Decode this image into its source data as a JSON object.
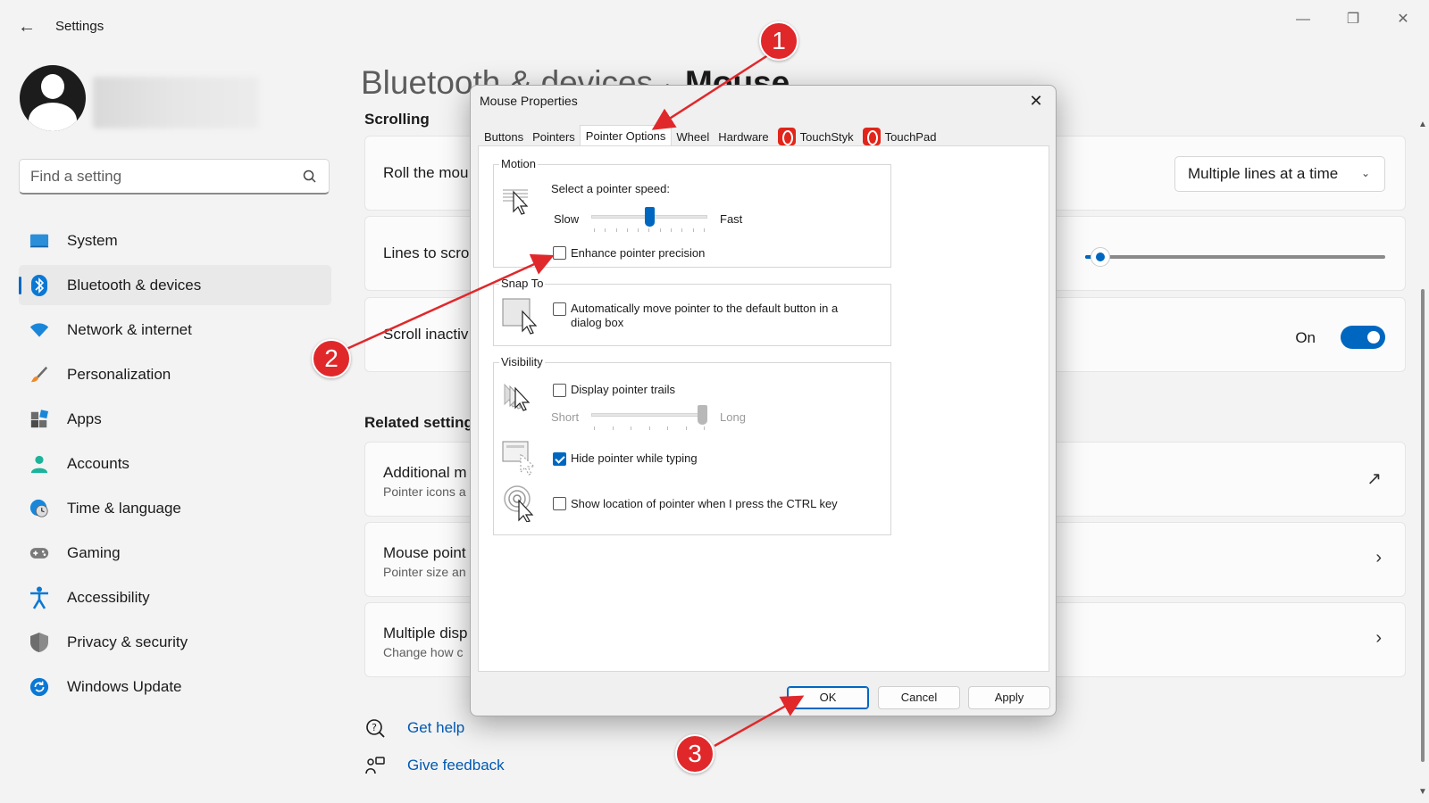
{
  "app": {
    "title": "Settings"
  },
  "search": {
    "placeholder": "Find a setting"
  },
  "sidebar": {
    "items": [
      {
        "label": "System",
        "icon": "system-icon"
      },
      {
        "label": "Bluetooth & devices",
        "icon": "bluetooth-icon",
        "active": true
      },
      {
        "label": "Network & internet",
        "icon": "wifi-icon"
      },
      {
        "label": "Personalization",
        "icon": "brush-icon"
      },
      {
        "label": "Apps",
        "icon": "apps-icon"
      },
      {
        "label": "Accounts",
        "icon": "accounts-icon"
      },
      {
        "label": "Time & language",
        "icon": "clock-globe-icon"
      },
      {
        "label": "Gaming",
        "icon": "gamepad-icon"
      },
      {
        "label": "Accessibility",
        "icon": "accessibility-icon"
      },
      {
        "label": "Privacy & security",
        "icon": "shield-icon"
      },
      {
        "label": "Windows Update",
        "icon": "update-icon"
      }
    ]
  },
  "header": {
    "crumb": "Bluetooth & devices",
    "separator": "›",
    "title": "Mouse"
  },
  "main": {
    "scrolling_label": "Scrolling",
    "roll_title": "Roll the mou",
    "roll_value": "Multiple lines at a time",
    "lines_title": "Lines to scro",
    "lines_slider_value": 0.05,
    "scroll_inactive_title": "Scroll inactiv",
    "scroll_inactive_state": "On",
    "related_label": "Related setting",
    "related": [
      {
        "title": "Additional m",
        "sub": "Pointer icons a"
      },
      {
        "title": "Mouse point",
        "sub": "Pointer size an"
      },
      {
        "title": "Multiple disp",
        "sub": "Change how c"
      }
    ],
    "get_help": "Get help",
    "give_feedback": "Give feedback"
  },
  "dialog": {
    "title": "Mouse Properties",
    "tabs": [
      "Buttons",
      "Pointers",
      "Pointer Options",
      "Wheel",
      "Hardware",
      "TouchStyk",
      "TouchPad"
    ],
    "active_tab": "Pointer Options",
    "motion": {
      "label": "Motion",
      "speed_label": "Select a pointer speed:",
      "slow": "Slow",
      "fast": "Fast",
      "speed_value": 0.5,
      "enhance_label": "Enhance pointer precision",
      "enhance_checked": false
    },
    "snap": {
      "label": "Snap To",
      "auto_move_label_1": "Automatically move pointer to the default button in a",
      "auto_move_label_2": "dialog box",
      "auto_move_checked": false
    },
    "visibility": {
      "label": "Visibility",
      "trails_label": "Display pointer trails",
      "trails_checked": false,
      "short": "Short",
      "long": "Long",
      "trails_value": 1.0,
      "hide_label": "Hide pointer while typing",
      "hide_checked": true,
      "ctrl_label": "Show location of pointer when I press the CTRL key",
      "ctrl_checked": false
    },
    "buttons": {
      "ok": "OK",
      "cancel": "Cancel",
      "apply": "Apply"
    }
  },
  "annotations": [
    "1",
    "2",
    "3"
  ],
  "colors": {
    "accent": "#0067c0",
    "marker": "#e0282b",
    "touch_logo": "#e1251b"
  }
}
